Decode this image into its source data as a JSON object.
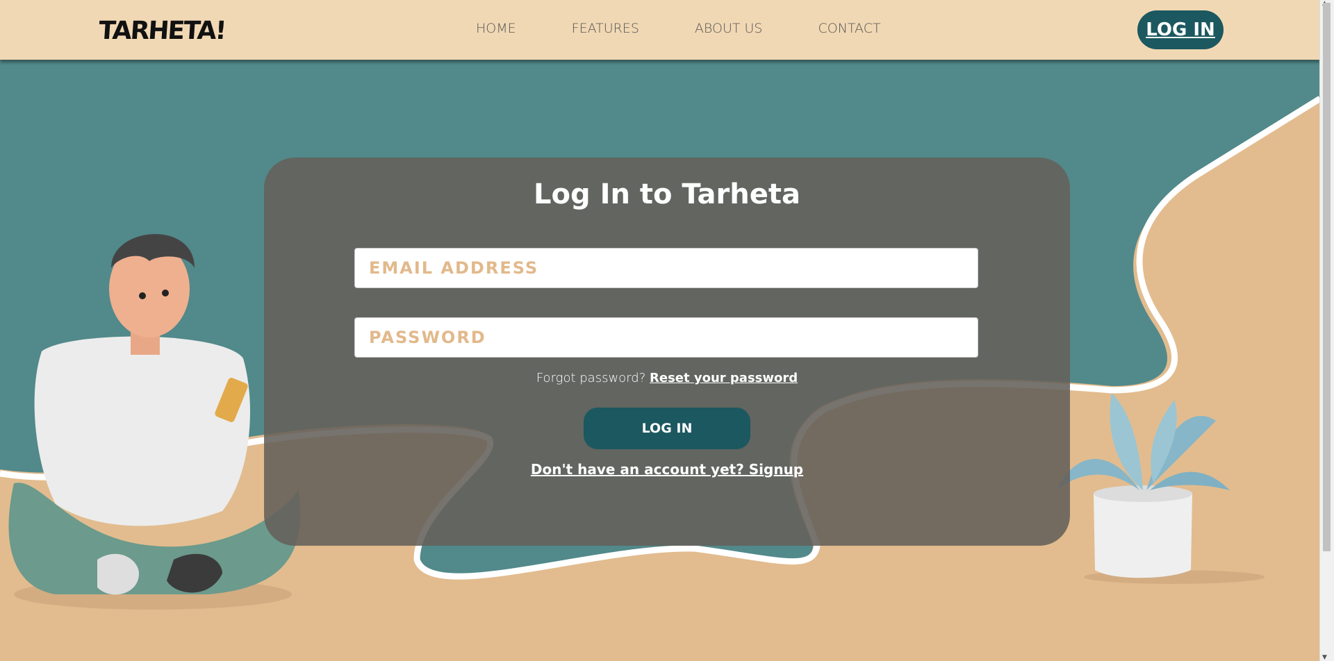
{
  "header": {
    "logo": "TARHETA!",
    "nav": [
      "HOME",
      "FEATURES",
      "ABOUT US",
      "CONTACT"
    ],
    "login_label": "LOG IN"
  },
  "card": {
    "title": "Log In to Tarheta",
    "email_placeholder": "EMAIL ADDRESS",
    "password_placeholder": "PASSWORD",
    "forgot_text": "Forgot password?",
    "reset_link": "Reset your password",
    "submit_label": "LOG IN",
    "signup_link": "Don't have an account yet? Signup"
  },
  "colors": {
    "header_bg": "#f1d8b4",
    "teal": "#52898a",
    "sand": "#e2bc8f",
    "accent": "#1c5860",
    "card_bg": "#64605a",
    "placeholder": "#e2b98b"
  },
  "icons": {
    "scroll_up": "▲",
    "scroll_down": "▼"
  }
}
